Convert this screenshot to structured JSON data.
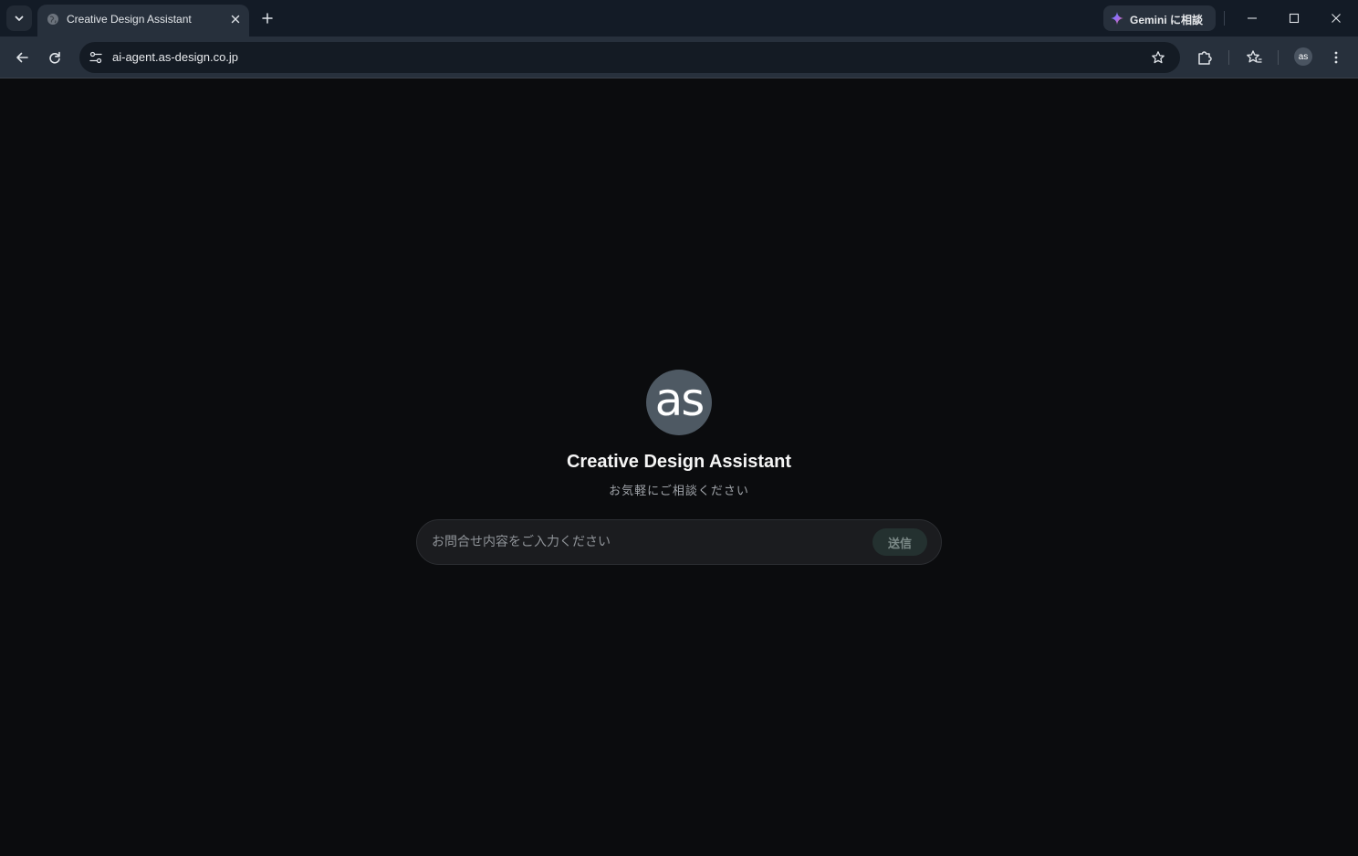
{
  "browser": {
    "tab": {
      "title": "Creative Design Assistant",
      "favicon": "globe-icon"
    },
    "gemini": {
      "label": "Gemini に相談"
    },
    "address_bar": {
      "url": "ai-agent.as-design.co.jp"
    },
    "profile": {
      "initials": "as"
    }
  },
  "page": {
    "logo_text": "as",
    "title": "Creative Design Assistant",
    "subtitle": "お気軽にご相談ください",
    "chat": {
      "placeholder": "お問合せ内容をご入力ください",
      "value": "",
      "send_label": "送信"
    }
  },
  "colors": {
    "page_background": "#0b0c0e",
    "chrome_background": "#131b26",
    "toolbar_background": "#27303c",
    "logo_background": "#4e5963",
    "send_button_background": "#243130"
  }
}
